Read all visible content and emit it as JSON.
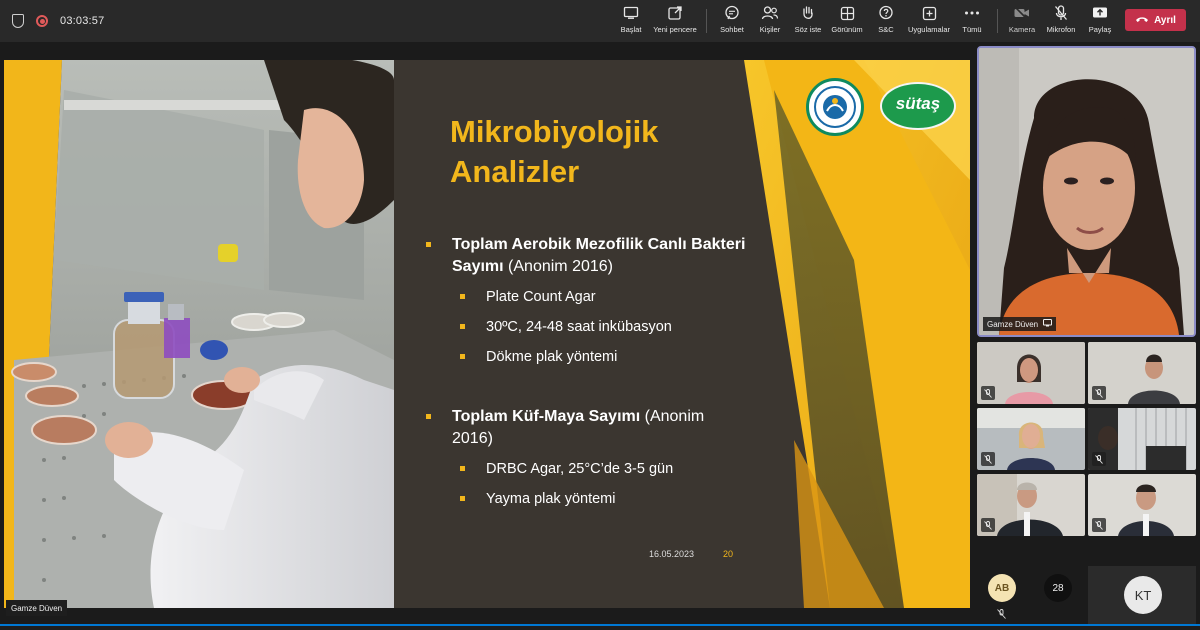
{
  "top_bar": {
    "shield_icon": "shield-icon",
    "record_icon": "record-icon",
    "timer": "03:03:57",
    "tools": [
      {
        "key": "start",
        "label": "Başlat",
        "icon": "screen-icon"
      },
      {
        "key": "new_window",
        "label": "Yeni pencere",
        "icon": "popout-icon"
      },
      {
        "key": "chat",
        "label": "Sohbet",
        "icon": "chat-icon"
      },
      {
        "key": "people",
        "label": "Kişiler",
        "icon": "people-icon"
      },
      {
        "key": "raise_hand",
        "label": "Söz iste",
        "icon": "hand-icon"
      },
      {
        "key": "view",
        "label": "Görünüm",
        "icon": "grid-icon"
      },
      {
        "key": "qa",
        "label": "S&C",
        "icon": "qa-icon"
      },
      {
        "key": "apps",
        "label": "Uygulamalar",
        "icon": "plus-icon"
      },
      {
        "key": "more",
        "label": "Tümü",
        "icon": "more-icon"
      },
      {
        "key": "camera",
        "label": "Kamera",
        "icon": "camera-off-icon"
      },
      {
        "key": "mic",
        "label": "Mikrofon",
        "icon": "mic-off-icon"
      },
      {
        "key": "share",
        "label": "Paylaş",
        "icon": "share-icon"
      }
    ],
    "leave_label": "Ayrıl",
    "leave_color": "#c4314b"
  },
  "slide": {
    "title_line1": "Mikrobiyolojik",
    "title_line2": "Analizler",
    "sections": [
      {
        "bold": "Toplam Aerobik Mezofilik Canlı Bakteri Sayımı",
        "rest": " (Anonim 2016)",
        "items": [
          "Plate Count Agar",
          "30ºC, 24-48 saat inkübasyon",
          "Dökme plak yöntemi"
        ]
      },
      {
        "bold": "Toplam Küf-Maya Sayımı",
        "rest": " (Anonim 2016)",
        "items": [
          "DRBC Agar, 25°C’de 3-5 gün",
          "Yayma plak yöntemi"
        ]
      }
    ],
    "date": "16.05.2023",
    "page_number": "20",
    "logo2_text": "sütaş",
    "accent_color": "#f2b71c"
  },
  "stage": {
    "presenter_name": "Gamze Düven"
  },
  "participants": {
    "spotlight_name": "Gamze Düven",
    "avatar_initials": "AB",
    "overflow_count": "28",
    "kt_initials": "KT"
  }
}
